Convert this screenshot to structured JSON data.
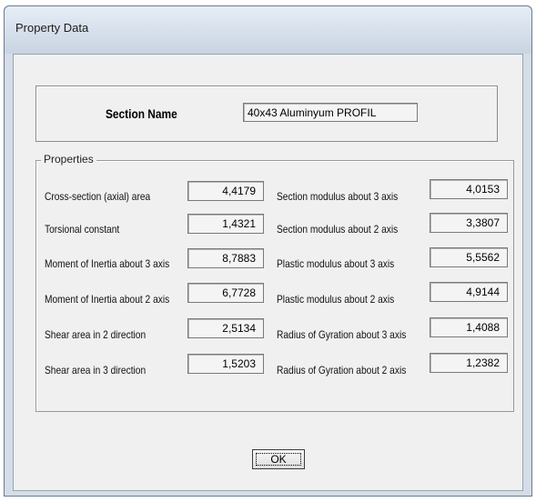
{
  "window": {
    "title": "Property Data"
  },
  "section": {
    "label": "Section Name",
    "value": "40x43 Aluminyum PROFIL"
  },
  "properties": {
    "group_label": "Properties",
    "left": [
      {
        "label": "Cross-section (axial) area",
        "value": "4,4179"
      },
      {
        "label": "Torsional constant",
        "value": "1,4321"
      },
      {
        "label": "Moment of Inertia about 3 axis",
        "value": "8,7883"
      },
      {
        "label": "Moment of Inertia about 2 axis",
        "value": "6,7728"
      },
      {
        "label": "Shear area in 2 direction",
        "value": "2,5134"
      },
      {
        "label": "Shear area in 3 direction",
        "value": "1,5203"
      }
    ],
    "right": [
      {
        "label": "Section modulus about 3 axis",
        "value": "4,0153"
      },
      {
        "label": "Section modulus about 2 axis",
        "value": "3,3807"
      },
      {
        "label": "Plastic modulus about 3 axis",
        "value": "5,5562"
      },
      {
        "label": "Plastic modulus about 2 axis",
        "value": "4,9144"
      },
      {
        "label": "Radius of Gyration about 3 axis",
        "value": "1,4088"
      },
      {
        "label": "Radius of Gyration about 2 axis",
        "value": "1,2382"
      }
    ]
  },
  "ok_button": {
    "label": "OK"
  }
}
